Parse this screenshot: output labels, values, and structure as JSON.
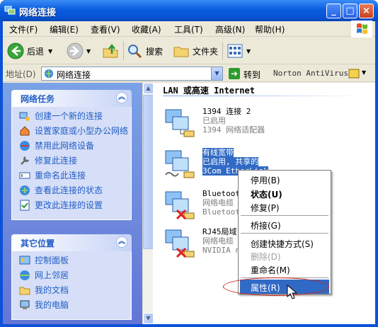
{
  "window": {
    "title": "网络连接",
    "buttons": {
      "minimize": "_",
      "maximize": "□",
      "close": "×"
    }
  },
  "menubar": [
    {
      "label": "文件(F)"
    },
    {
      "label": "编辑(E)"
    },
    {
      "label": "查看(V)"
    },
    {
      "label": "收藏(A)"
    },
    {
      "label": "工具(T)"
    },
    {
      "label": "高级(N)"
    },
    {
      "label": "帮助(H)"
    }
  ],
  "toolbar": {
    "back": "后退",
    "search": "搜索",
    "folders": "文件夹"
  },
  "address": {
    "label": "地址(D)",
    "value": "网络连接",
    "go": "转到",
    "norton": "Norton AntiVirus"
  },
  "tasks": {
    "title": "网络任务",
    "items": [
      {
        "label": "创建一个新的连接",
        "icon": "new-connection-icon"
      },
      {
        "label": "设置家庭或小型办公网络",
        "icon": "home-network-icon"
      },
      {
        "label": "禁用此网络设备",
        "icon": "disable-device-icon"
      },
      {
        "label": "修复此连接",
        "icon": "repair-icon"
      },
      {
        "label": "重命名此连接",
        "icon": "rename-icon"
      },
      {
        "label": "查看此连接的状态",
        "icon": "status-icon"
      },
      {
        "label": "更改此连接的设置",
        "icon": "settings-icon"
      }
    ]
  },
  "other_places": {
    "title": "其它位置",
    "items": [
      {
        "label": "控制面板",
        "icon": "control-panel-icon"
      },
      {
        "label": "网上邻居",
        "icon": "network-places-icon"
      },
      {
        "label": "我的文档",
        "icon": "my-documents-icon"
      },
      {
        "label": "我的电脑",
        "icon": "my-computer-icon"
      }
    ]
  },
  "group_header": "LAN 或高速 Internet",
  "connections": [
    {
      "name": "1394 连接 2",
      "status": "已启用",
      "device": "1394 网络适配器"
    },
    {
      "name": "有线宽带",
      "status": "已启用, 共享的",
      "device": "3Com EtherLink"
    },
    {
      "name": "Bluetooth",
      "status": "网络电缆",
      "device": "Bluetooth"
    },
    {
      "name": "RJ45局域",
      "status": "网络电缆",
      "device": "NVIDIA n"
    }
  ],
  "context_menu": [
    {
      "label": "停用(B)",
      "state": "normal"
    },
    {
      "label": "状态(U)",
      "state": "bold"
    },
    {
      "label": "修复(P)",
      "state": "normal"
    },
    {
      "label": "桥接(G)",
      "state": "normal"
    },
    {
      "label": "创建快捷方式(S)",
      "state": "normal"
    },
    {
      "label": "删除(D)",
      "state": "disabled"
    },
    {
      "label": "重命名(M)",
      "state": "normal"
    },
    {
      "label": "属性(R)",
      "state": "highlighted"
    }
  ],
  "colors": {
    "titlebar": "#0654d4",
    "taskpane": "#6375d6",
    "link": "#215dc6",
    "selection": "#316ac5",
    "annotation": "#d02020"
  }
}
